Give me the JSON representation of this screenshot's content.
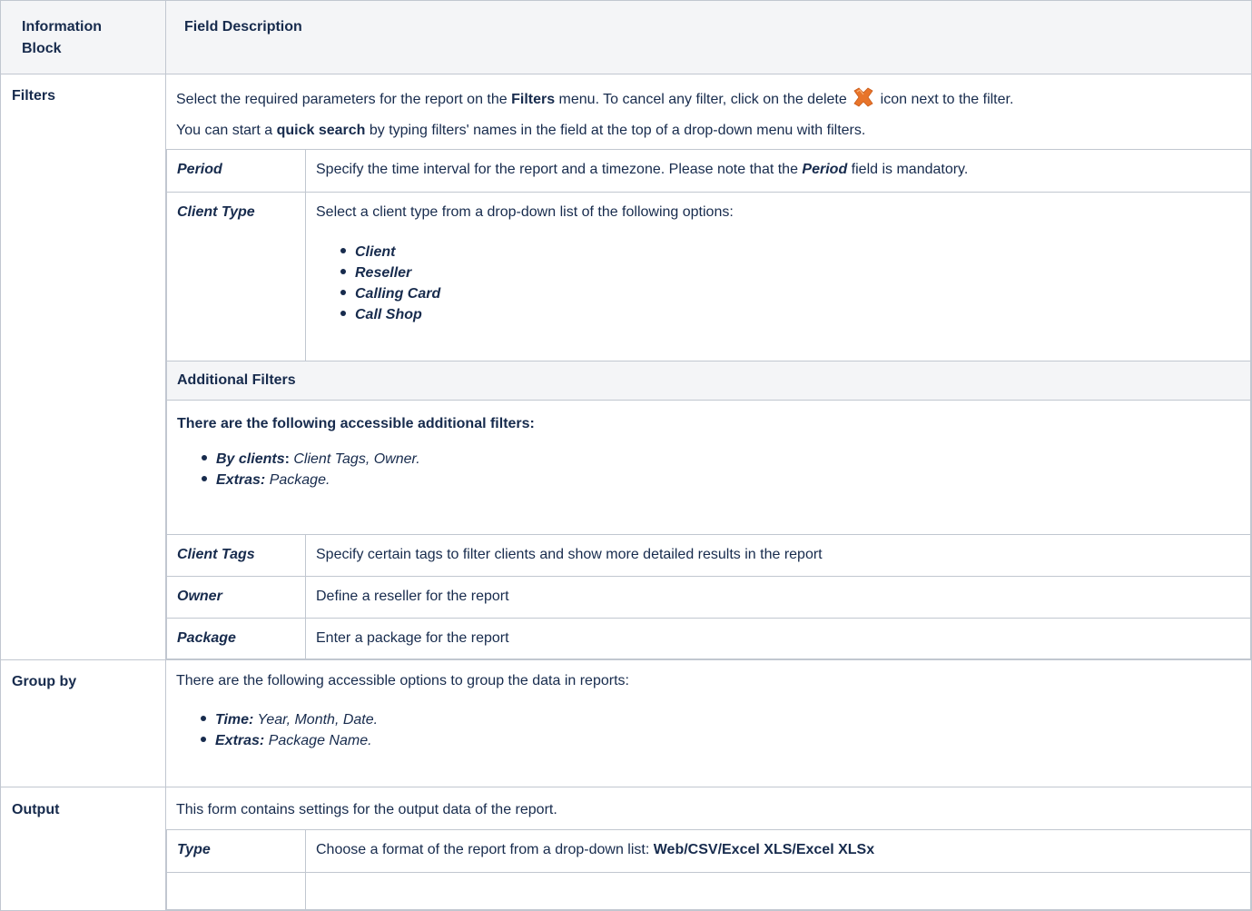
{
  "header": {
    "col1": "Information Block",
    "col1_line1": "Information",
    "col1_line2": "Block",
    "col2": "Field Description"
  },
  "filters": {
    "label": "Filters",
    "p1_a": "Select the required parameters for the report on the ",
    "p1_b": "Filters",
    "p1_c": " menu. To cancel any filter, click on the delete ",
    "p1_d": " icon next to the filter.",
    "p2_a": "You can start a ",
    "p2_b": "quick search",
    "p2_c": " by typing filters' names in the field at the top of a drop-down menu with filters.",
    "period": {
      "label": "Period",
      "desc_a": "Specify the time interval for the report and a timezone. Please note that the ",
      "desc_b": "Period",
      "desc_c": " field is mandatory."
    },
    "client_type": {
      "label": "Client Type",
      "desc": "Select a client type from a drop-down list of the following options:",
      "options": [
        "Client",
        "Reseller",
        "Calling Card",
        "Call Shop"
      ]
    },
    "additional": {
      "heading": "Additional Filters",
      "intro": "There are the following accessible additional filters:",
      "items": [
        {
          "key": "By clients",
          "sep": ":",
          "value": " Client Tags, Owner."
        },
        {
          "key": "Extras:",
          "sep": "",
          "value": " Package."
        }
      ]
    },
    "rows": [
      {
        "label": "Client Tags",
        "desc": "Specify certain tags to filter clients and show more detailed results in the report"
      },
      {
        "label": "Owner",
        "desc": "Define a reseller for the report"
      },
      {
        "label": "Package",
        "desc": "Enter a package for the report"
      }
    ]
  },
  "group_by": {
    "label": "Group by",
    "intro": "There are the following accessible options to group the data in reports:",
    "items": [
      {
        "key": "Time:",
        "value": " Year, Month, Date."
      },
      {
        "key": "Extras:",
        "value": " Package Name."
      }
    ]
  },
  "output": {
    "label": "Output",
    "intro": "This form contains settings for the output data of the report.",
    "type": {
      "label": "Type",
      "desc_a": "Choose a format of the report from a drop-down list: ",
      "desc_b": "Web/CSV/Excel XLS/Excel XLSx"
    }
  },
  "colors": {
    "border": "#c1c7d0",
    "header_bg": "#f4f5f7",
    "text": "#172b4d",
    "delete_icon": "#e8742a"
  },
  "icons": {
    "delete": "delete-x-icon"
  }
}
